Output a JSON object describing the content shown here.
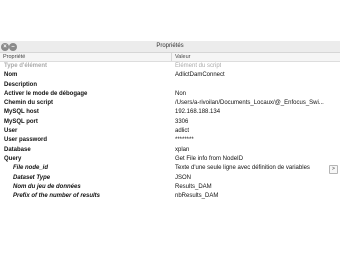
{
  "window": {
    "title": "Propriétés"
  },
  "table": {
    "header_property": "Propriété",
    "header_value": "Valeur"
  },
  "rows": [
    {
      "label": "Type d'élément",
      "value": "Élément du script"
    },
    {
      "label": "Nom",
      "value": "AdlictDamConnect"
    },
    {
      "label": "Description",
      "value": ""
    },
    {
      "label": "Activer le mode de débogage",
      "value": "Non"
    },
    {
      "label": "Chemin du script",
      "value": "/Users/a-rivoilan/Documents_Locaux/@_Enfocus_Swi..."
    },
    {
      "label": "MySQL host",
      "value": "192.168.188.134"
    },
    {
      "label": "MySQL port",
      "value": "3306"
    },
    {
      "label": "User",
      "value": "adlict"
    },
    {
      "label": "User password",
      "value": "********"
    },
    {
      "label": "Database",
      "value": "xplan"
    },
    {
      "label": "Query",
      "value": "Get File info from NodeID"
    },
    {
      "label": "File node_id",
      "value": "Texte d'une seule ligne avec définition de variables",
      "button": ">"
    },
    {
      "label": "Dataset Type",
      "value": "JSON"
    },
    {
      "label": "Nom du jeu de données",
      "value": "Results_DAM"
    },
    {
      "label": "Prefix of the number of results",
      "value": "nbResults_DAM"
    }
  ]
}
